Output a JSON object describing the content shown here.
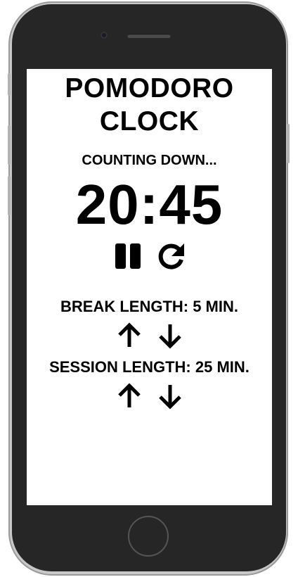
{
  "app": {
    "title_line1": "POMODORO",
    "title_line2": "CLOCK",
    "status": "COUNTING DOWN...",
    "timer": "20:45"
  },
  "controls": {
    "pause_icon": "pause-icon",
    "reset_icon": "reset-icon"
  },
  "break": {
    "label": "BREAK LENGTH: 5 MIN.",
    "increment_icon": "arrow-up-icon",
    "decrement_icon": "arrow-down-icon"
  },
  "session": {
    "label": "SESSION LENGTH: 25 MIN.",
    "increment_icon": "arrow-up-icon",
    "decrement_icon": "arrow-down-icon"
  },
  "colors": {
    "text": "#000000",
    "screen": "#ffffff",
    "phone_body": "#262626",
    "phone_frame": "#c9c9c9"
  }
}
